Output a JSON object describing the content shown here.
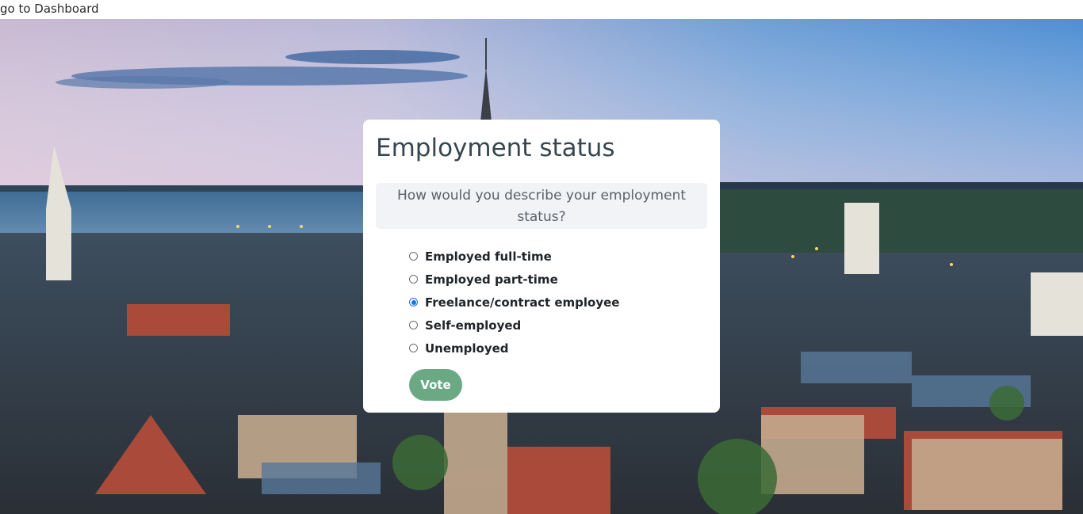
{
  "nav": {
    "dashboard_link": "go to Dashboard"
  },
  "poll": {
    "title": "Employment status",
    "question": "How would you describe your employment status?",
    "options": [
      {
        "label": "Employed full-time",
        "checked": false
      },
      {
        "label": "Employed part-time",
        "checked": false
      },
      {
        "label": "Freelance/contract employee",
        "checked": true
      },
      {
        "label": "Self-employed",
        "checked": false
      },
      {
        "label": "Unemployed",
        "checked": false
      }
    ],
    "vote_label": "Vote"
  },
  "colors": {
    "vote_button": "#6aa984",
    "radio_selected": "#1a73e8",
    "question_bg": "#f1f3f6"
  },
  "background": {
    "icon": "city-skyline-photo"
  }
}
